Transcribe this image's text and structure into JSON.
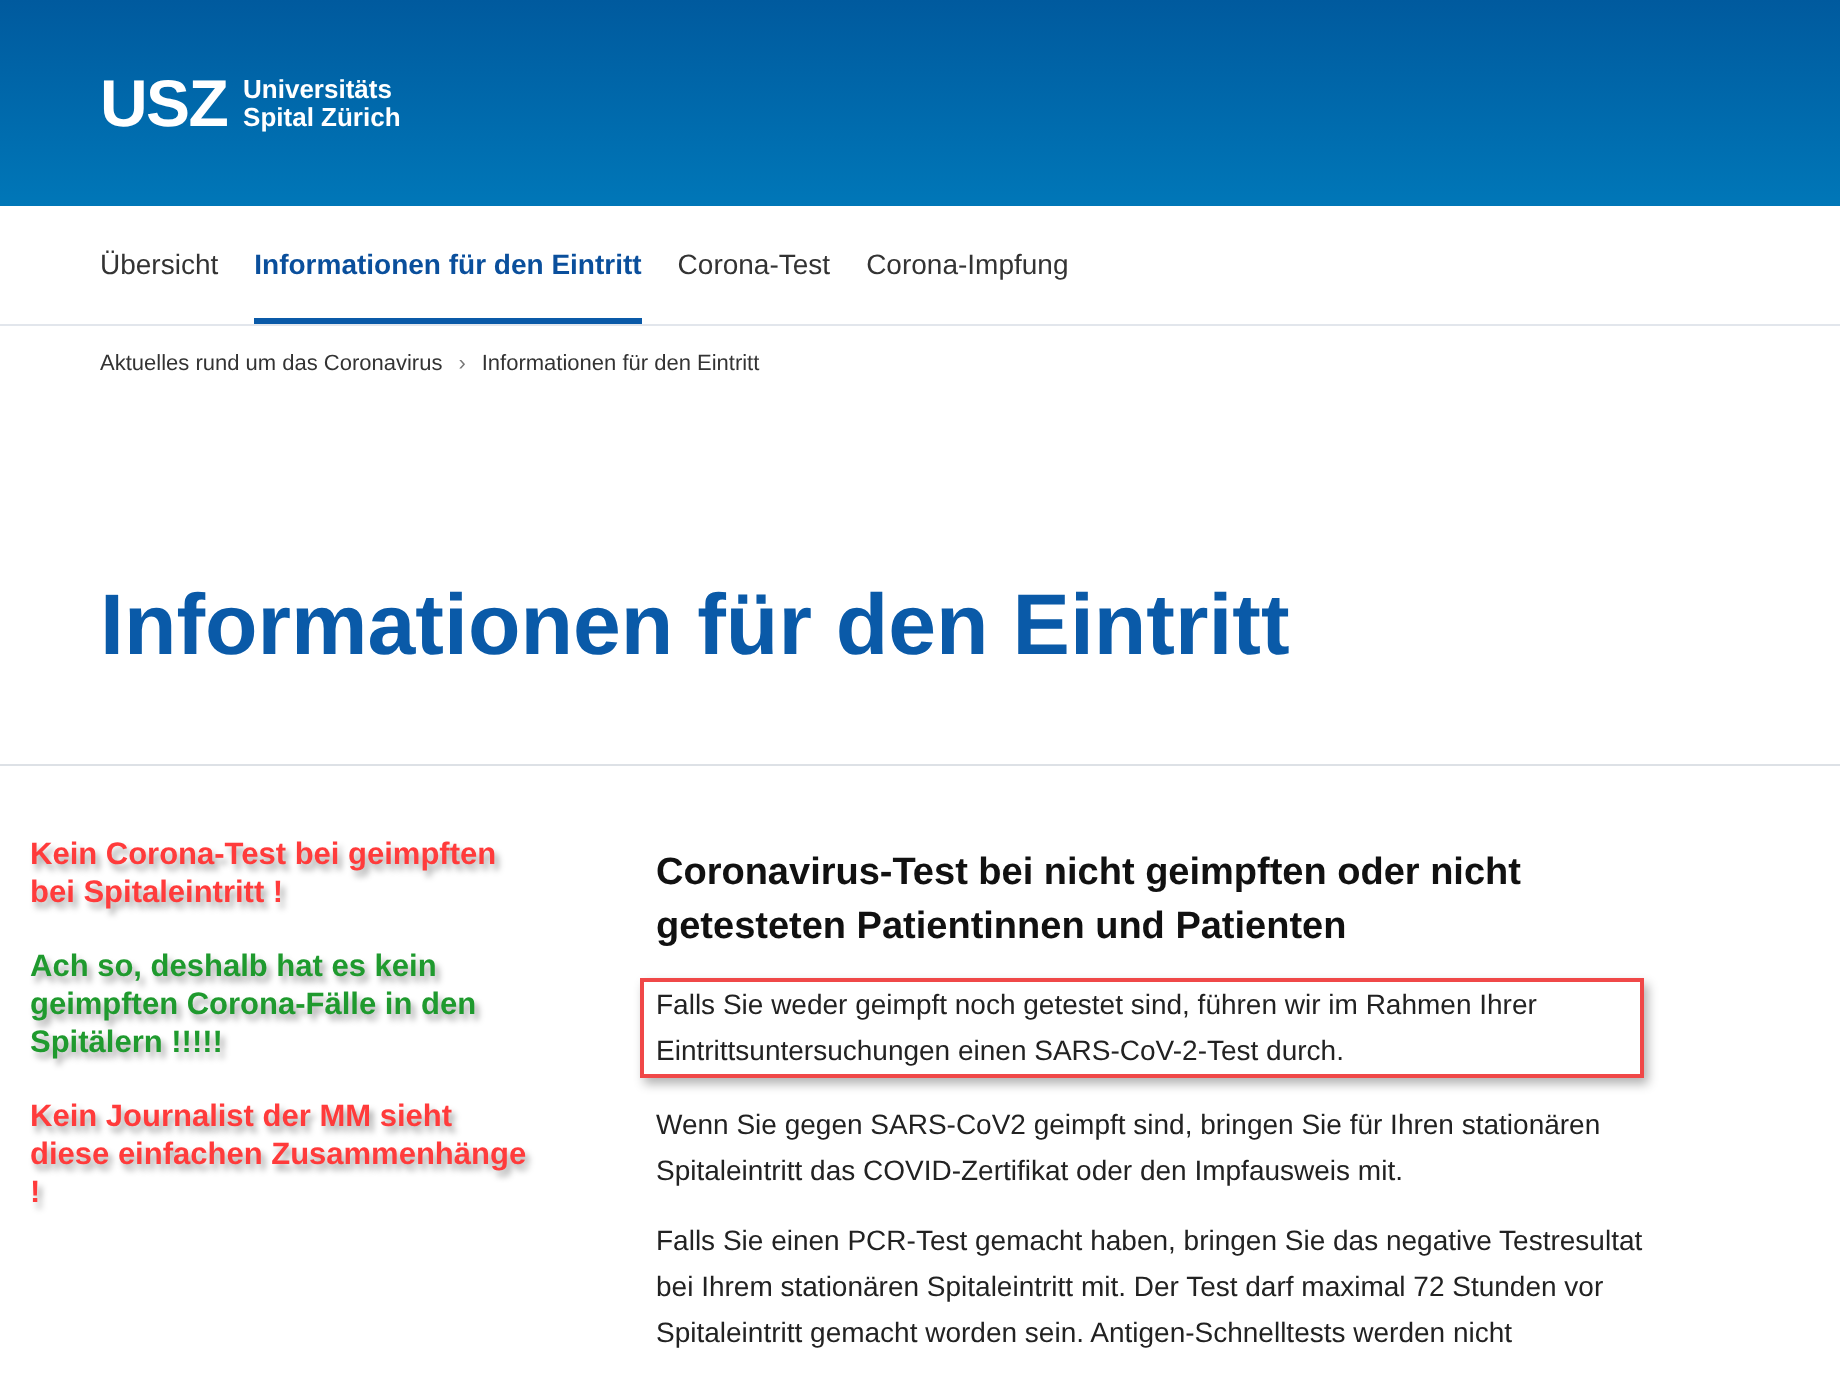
{
  "header": {
    "logo_mark": "USZ",
    "logo_text": [
      "Universitäts",
      "Spital Zürich"
    ]
  },
  "tabs": [
    {
      "label": "Übersicht",
      "selected": false
    },
    {
      "label": "Informationen für den Eintritt",
      "selected": true
    },
    {
      "label": "Corona-Test",
      "selected": false
    },
    {
      "label": "Corona-Impfung",
      "selected": false
    }
  ],
  "breadcrumb": [
    "Aktuelles rund um das Coronavirus",
    "Informationen für den Eintritt"
  ],
  "breadcrumb_separator": "›",
  "page_title": "Informationen für den Eintritt",
  "annotations": [
    {
      "text": "Kein Corona-Test bei geimpften bei Spitaleintritt !",
      "color": "#ff3b3b"
    },
    {
      "text": "Ach so, deshalb hat es kein geimpften Corona-Fälle in den Spitälern !!!!!",
      "color": "#1f9a2e"
    },
    {
      "text": "Kein Journalist der MM sieht diese einfachen Zusammenhänge !",
      "color": "#ff3b3b"
    }
  ],
  "section": {
    "heading": "Coronavirus-Test bei nicht geimpften oder nicht getesteten Patientinnen und Patienten",
    "paragraphs": [
      {
        "text": "Falls Sie weder geimpft noch getestet sind, führen wir im Rahmen Ihrer Eintrittsuntersuchungen einen SARS-CoV-2-Test durch.",
        "highlighted": true
      },
      {
        "text": "Wenn Sie gegen SARS-CoV2 geimpft sind, bringen Sie für Ihren stationären Spitaleintritt das COVID-Zertifikat oder den Impfausweis mit.",
        "highlighted": false
      },
      {
        "text": "Falls Sie einen PCR-Test gemacht haben, bringen Sie das negative Testresultat bei Ihrem stationären Spitaleintritt mit. Der Test darf maximal 72 Stunden vor Spitaleintritt gemacht worden sein. Antigen-Schnelltests werden nicht",
        "highlighted": false
      }
    ]
  }
}
